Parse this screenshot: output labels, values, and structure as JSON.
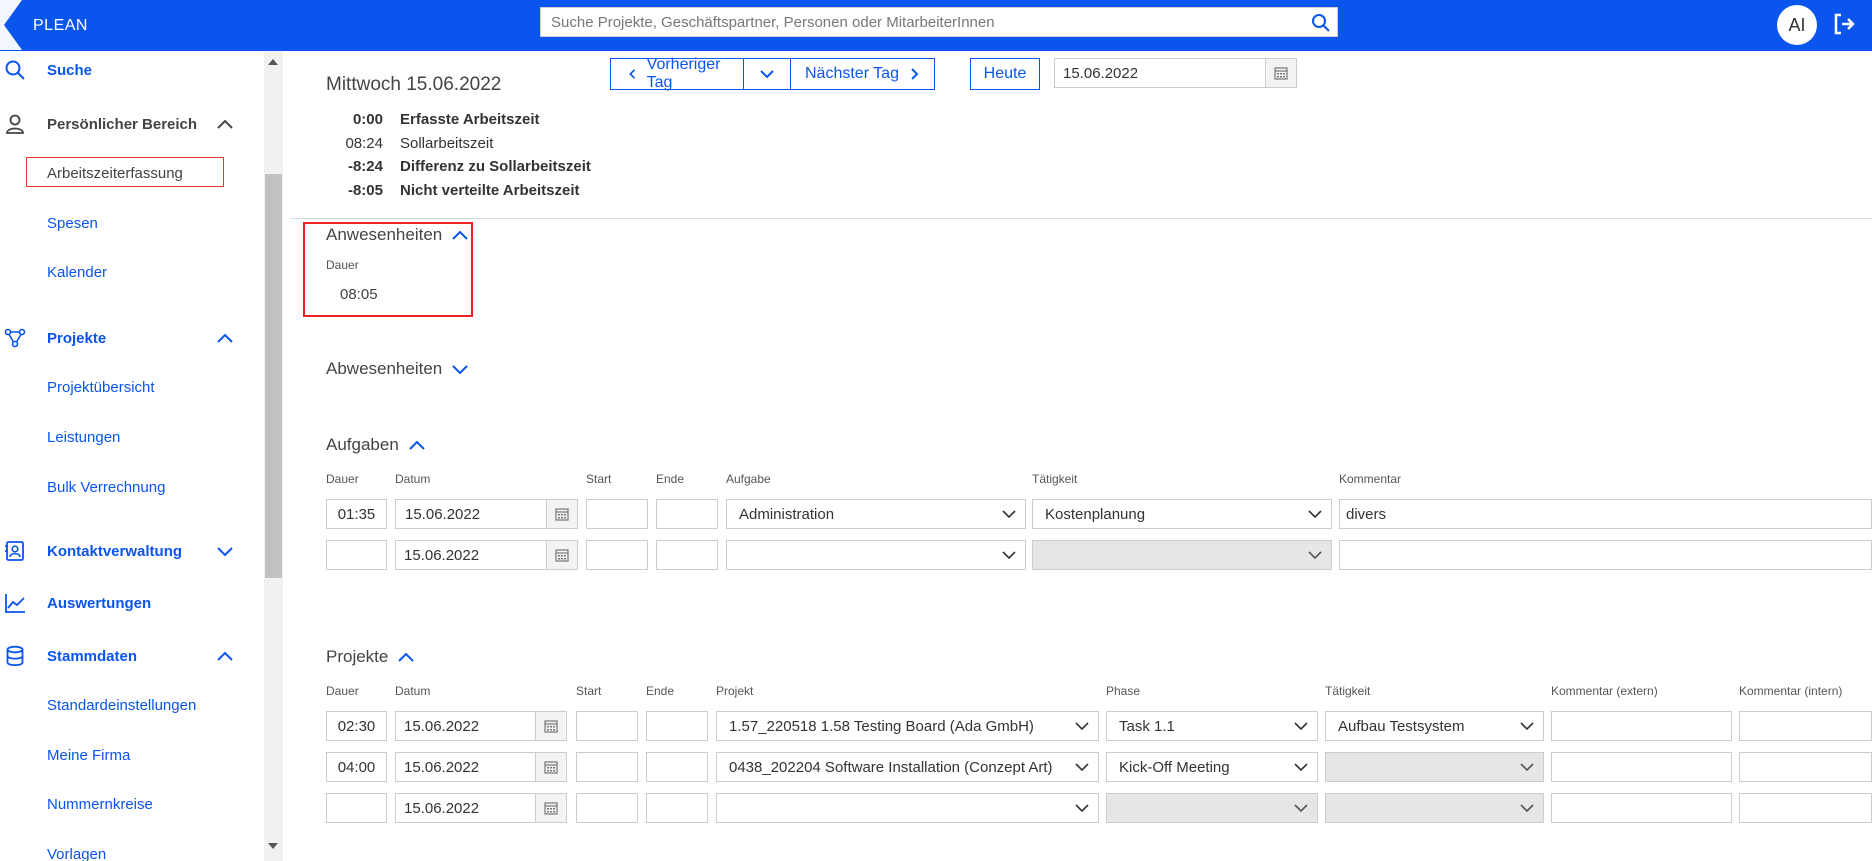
{
  "app": {
    "logo_text": "PLEAN",
    "search_placeholder": "Suche Projekte, Geschäftspartner, Personen oder MitarbeiterInnen",
    "avatar_initials": "AI",
    "brand_color": "#0a55ee"
  },
  "sidebar": {
    "search": "Suche",
    "personal": "Persönlicher Bereich",
    "arbeitszeit": "Arbeitszeiterfassung",
    "spesen": "Spesen",
    "kalender": "Kalender",
    "projekte": "Projekte",
    "projektuebersicht": "Projektübersicht",
    "leistungen": "Leistungen",
    "bulk": "Bulk Verrechnung",
    "kontakt": "Kontaktverwaltung",
    "auswertungen": "Auswertungen",
    "stammdaten": "Stammdaten",
    "standard": "Standardeinstellungen",
    "firma": "Meine Firma",
    "nummern": "Nummernkreise",
    "vorlagen": "Vorlagen"
  },
  "header": {
    "day_title": "Mittwoch 15.06.2022",
    "prev_label": "Vorheriger Tag",
    "next_label": "Nächster Tag",
    "today_label": "Heute",
    "date_value": "15.06.2022"
  },
  "summary": [
    {
      "value": "0:00",
      "label": "Erfasste Arbeitszeit"
    },
    {
      "value": "08:24",
      "label": "Sollarbeitszeit"
    },
    {
      "value": "-8:24",
      "label": "Differenz zu Sollarbeitszeit"
    },
    {
      "value": "-8:05",
      "label": "Nicht verteilte Arbeitszeit"
    }
  ],
  "anwesenheiten": {
    "title": "Anwesenheiten",
    "dauer_label": "Dauer",
    "dauer_value": "08:05"
  },
  "abwesenheiten": {
    "title": "Abwesenheiten"
  },
  "aufgaben": {
    "title": "Aufgaben",
    "headers": [
      "Dauer",
      "Datum",
      "Start",
      "Ende",
      "Aufgabe",
      "Tätigkeit",
      "Kommentar"
    ],
    "rows": [
      {
        "dauer": "01:35",
        "datum": "15.06.2022",
        "start": "",
        "ende": "",
        "aufgabe": "Administration",
        "taetigkeit": "Kostenplanung",
        "kommentar": "divers"
      },
      {
        "dauer": "",
        "datum": "15.06.2022",
        "start": "",
        "ende": "",
        "aufgabe": "",
        "taetigkeit": "",
        "kommentar": ""
      }
    ]
  },
  "projekte": {
    "title": "Projekte",
    "headers": [
      "Dauer",
      "Datum",
      "Start",
      "Ende",
      "Projekt",
      "Phase",
      "Tätigkeit",
      "Kommentar (extern)",
      "Kommentar (intern)"
    ],
    "rows": [
      {
        "dauer": "02:30",
        "datum": "15.06.2022",
        "projekt": "1.57_220518 1.58 Testing Board (Ada GmbH)",
        "phase": "Task 1.1",
        "taetigkeit": "Aufbau Testsystem"
      },
      {
        "dauer": "04:00",
        "datum": "15.06.2022",
        "projekt": "0438_202204 Software Installation (Conzept Art)",
        "phase": "Kick-Off Meeting",
        "taetigkeit": ""
      },
      {
        "dauer": "",
        "datum": "15.06.2022",
        "projekt": "",
        "phase": "",
        "taetigkeit": ""
      }
    ]
  }
}
